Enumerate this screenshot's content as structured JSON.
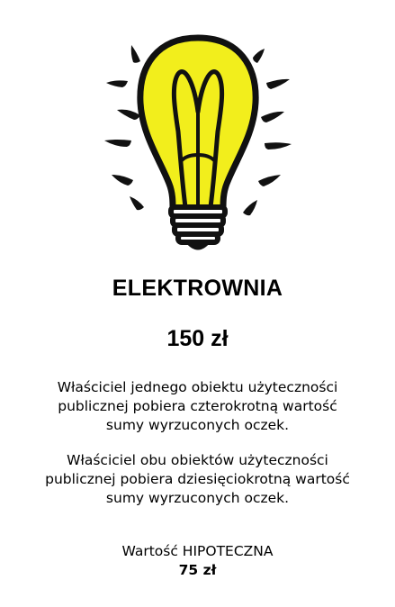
{
  "card": {
    "name": "ELEKTROWNIA",
    "price": "150 zł",
    "rule_one_owned": "Właściciel jednego obiektu użyteczności\npublicznej pobiera czterokrotną wartość\nsumy wyrzuconych oczek.",
    "rule_both_owned": "Właściciel obu obiektów użyteczności\npublicznej pobiera dziesięciokrotną wartość\nsumy wyrzuconych oczek.",
    "mortgage_label": "Wartość HIPOTECZNA",
    "mortgage_value": "75 zł",
    "icon": "light-bulb-icon",
    "colors": {
      "bulb_fill": "#f2ee1c",
      "outline": "#111111",
      "background": "#ffffff"
    }
  }
}
